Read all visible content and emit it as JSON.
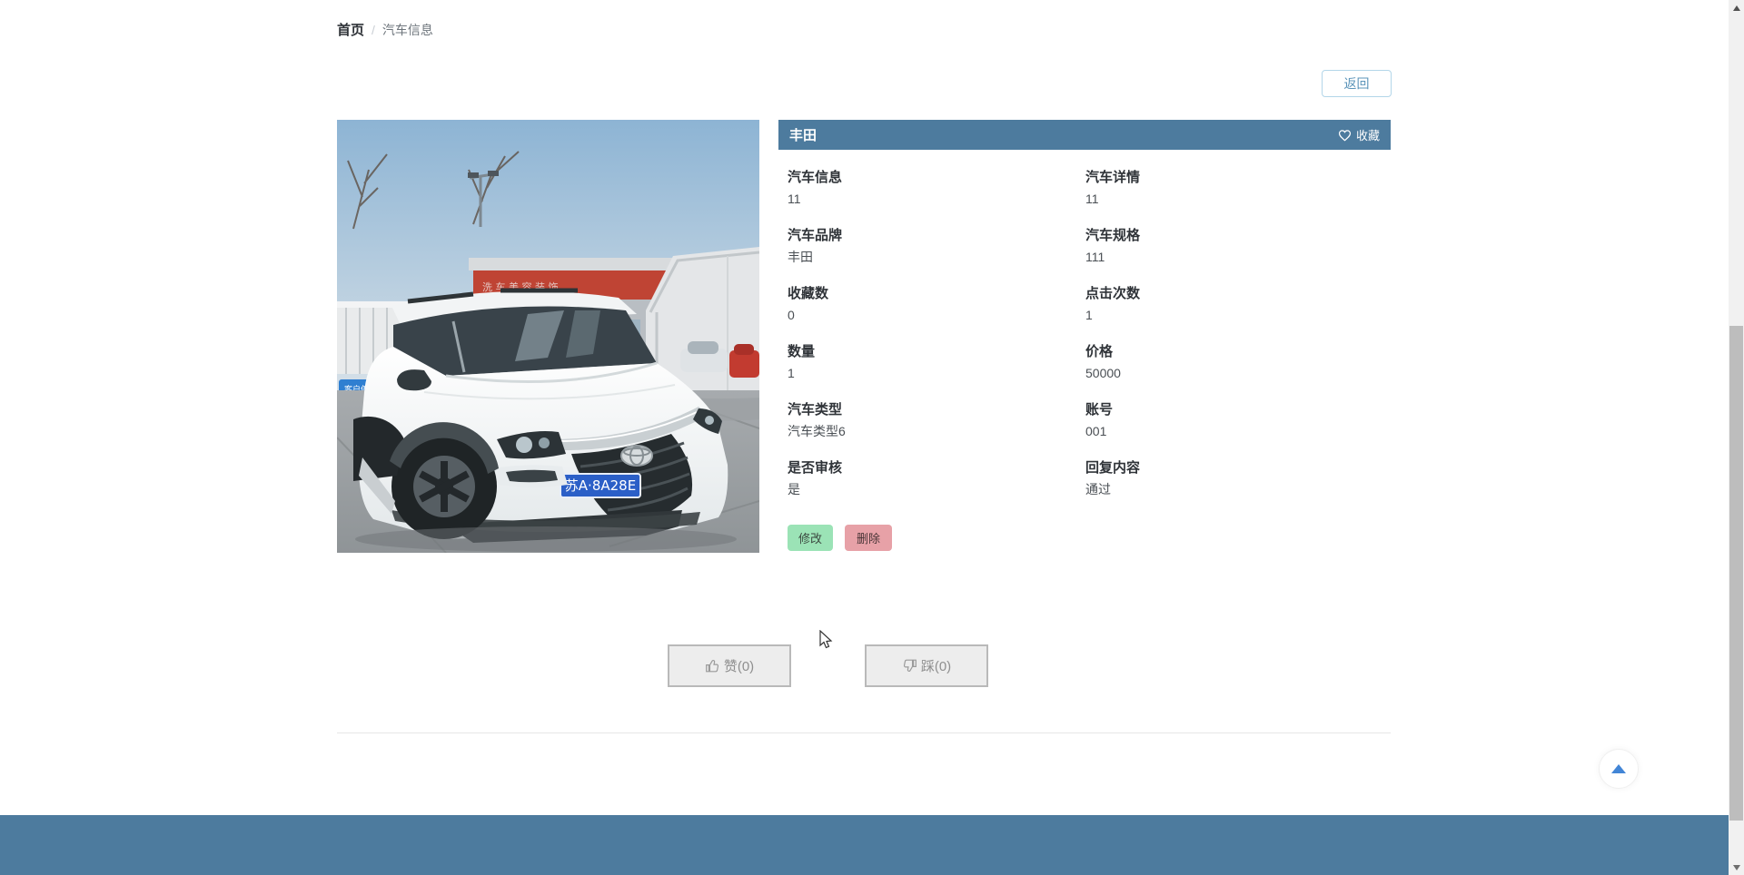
{
  "page": {
    "breadcrumb": {
      "home": "首页",
      "separator": "/",
      "current": "汽车信息"
    },
    "back_button": "返回"
  },
  "detail": {
    "title": "丰田",
    "favorite_label": "收藏",
    "favorite_icon": "heart-outline-icon",
    "fields": [
      {
        "label": "汽车信息",
        "value": "11"
      },
      {
        "label": "汽车详情",
        "value": "11"
      },
      {
        "label": "汽车品牌",
        "value": "丰田"
      },
      {
        "label": "汽车规格",
        "value": "111"
      },
      {
        "label": "收藏数",
        "value": "0"
      },
      {
        "label": "点击次数",
        "value": "1"
      },
      {
        "label": "数量",
        "value": "1"
      },
      {
        "label": "价格",
        "value": "50000"
      },
      {
        "label": "汽车类型",
        "value": "汽车类型6"
      },
      {
        "label": "账号",
        "value": "001"
      },
      {
        "label": "是否审核",
        "value": "是"
      },
      {
        "label": "回复内容",
        "value": "通过"
      }
    ],
    "actions": {
      "edit": "修改",
      "delete": "删除"
    }
  },
  "vote": {
    "like_label": "赞(0)",
    "like_icon": "thumbs-up-icon",
    "dislike_label": "踩(0)",
    "dislike_icon": "thumbs-down-icon"
  },
  "photo": {
    "license_plate": "苏A·8A28E"
  },
  "colors": {
    "accent_teal": "#4d7b9e",
    "edit_green": "#9be3b6",
    "delete_red": "#e7a1a7",
    "back_blue": "#5b94b9",
    "plate_blue": "#2b5fc7"
  }
}
